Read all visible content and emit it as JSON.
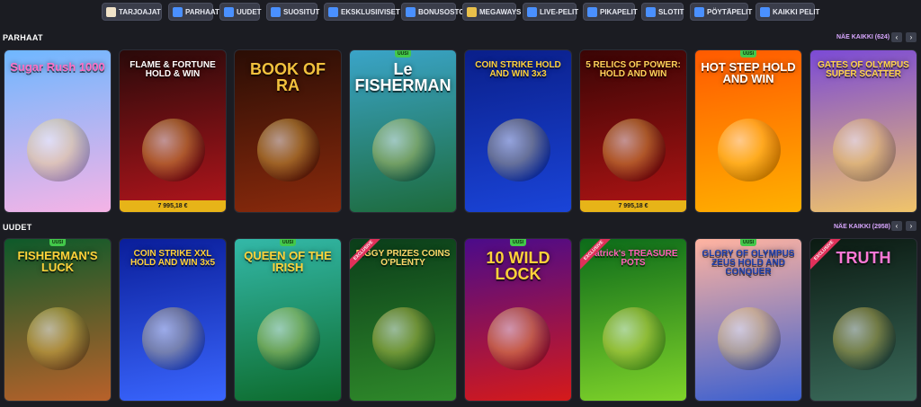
{
  "nav": {
    "chips": [
      {
        "label": "TARJOAJAT",
        "icon": "provider-icon",
        "color": "#f0e2c8"
      },
      {
        "label": "PARHAAT",
        "icon": "star-icon",
        "color": "#4a90ff"
      },
      {
        "label": "UUDET",
        "icon": "lightning-icon",
        "color": "#4a90ff"
      },
      {
        "label": "SUOSITUT",
        "icon": "flame-icon",
        "color": "#4a90ff"
      },
      {
        "label": "EKSKLUSIIVISET",
        "icon": "diamond-icon",
        "color": "#4a90ff"
      },
      {
        "label": "BONUSOSTO",
        "icon": "gift-icon",
        "color": "#4a90ff"
      },
      {
        "label": "MEGAWAYS",
        "icon": "megaways-icon",
        "color": "#e9c04a"
      },
      {
        "label": "LIVE-PELIT",
        "icon": "live-icon",
        "color": "#4a90ff"
      },
      {
        "label": "PIKAPELIT",
        "icon": "gamepad-icon",
        "color": "#4a90ff"
      },
      {
        "label": "SLOTIT",
        "icon": "slots-icon",
        "color": "#4a90ff"
      },
      {
        "label": "PÖYTÄPELIT",
        "icon": "cards-icon",
        "color": "#4a90ff"
      },
      {
        "label": "KAIKKI PELIT",
        "icon": "rocket-icon",
        "color": "#4a90ff"
      }
    ]
  },
  "sections": [
    {
      "title": "PARHAAT",
      "view_all": "NÄE KAIKKI (624)",
      "games": [
        {
          "title": "Sugar Rush 1000",
          "badge": "",
          "exclusive": "",
          "jackpot": "",
          "bg1": "#6fb7ff",
          "bg2": "#f5b3e6",
          "color": "#ff6fc4"
        },
        {
          "title": "FLAME & FORTUNE HOLD & WIN",
          "badge": "",
          "exclusive": "",
          "jackpot": "7 995,18 €",
          "bg1": "#2a0a0a",
          "bg2": "#b3151c",
          "color": "#ffffff"
        },
        {
          "title": "BOOK OF RA",
          "badge": "",
          "exclusive": "",
          "jackpot": "",
          "bg1": "#2a0d05",
          "bg2": "#8a2a0c",
          "color": "#f2c13d"
        },
        {
          "title": "Le FISHERMAN",
          "badge": "UUSI",
          "exclusive": "",
          "jackpot": "",
          "bg1": "#3aa4c8",
          "bg2": "#1d6b3c",
          "color": "#ffffff"
        },
        {
          "title": "COIN STRIKE HOLD AND WIN 3x3",
          "badge": "",
          "exclusive": "",
          "jackpot": "",
          "bg1": "#0a1f8a",
          "bg2": "#1a44d8",
          "color": "#ffd23a"
        },
        {
          "title": "5 RELICS OF POWER: HOLD AND WIN",
          "badge": "",
          "exclusive": "",
          "jackpot": "7 995,18 €",
          "bg1": "#3a0505",
          "bg2": "#b01414",
          "color": "#ffd35a"
        },
        {
          "title": "HOT STEP HOLD AND WIN",
          "badge": "UUSI",
          "exclusive": "",
          "jackpot": "",
          "bg1": "#ff5a00",
          "bg2": "#ffb000",
          "color": "#ffffff"
        },
        {
          "title": "GATES OF OLYMPUS SUPER SCATTER",
          "badge": "",
          "exclusive": "",
          "jackpot": "",
          "bg1": "#7b4ad6",
          "bg2": "#f0c46a",
          "color": "#ffd34a"
        }
      ]
    },
    {
      "title": "UUDET",
      "view_all": "NÄE KAIKKI (2958)",
      "games": [
        {
          "title": "FISHERMAN'S LUCK",
          "badge": "UUSI",
          "exclusive": "",
          "jackpot": "",
          "bg1": "#0d5a2a",
          "bg2": "#b8612a",
          "color": "#ffd23a"
        },
        {
          "title": "COIN STRIKE XXL HOLD AND WIN 3x5",
          "badge": "",
          "exclusive": "",
          "jackpot": "",
          "bg1": "#0a1e9a",
          "bg2": "#3a66ff",
          "color": "#ffd23a"
        },
        {
          "title": "QUEEN OF THE IRISH",
          "badge": "UUSI",
          "exclusive": "",
          "jackpot": "",
          "bg1": "#33b8a8",
          "bg2": "#0d6b2c",
          "color": "#ffd23a"
        },
        {
          "title": "PIGGY PRIZES COINS O'PLENTY",
          "badge": "",
          "exclusive": "EXCLUSIVE",
          "jackpot": "",
          "bg1": "#0b3d1a",
          "bg2": "#2f8a2a",
          "color": "#ffd86b"
        },
        {
          "title": "10 WILD LOCK",
          "badge": "UUSI",
          "exclusive": "",
          "jackpot": "",
          "bg1": "#4b0b8a",
          "bg2": "#d51a1a",
          "color": "#ffd23a"
        },
        {
          "title": "Patrick's TREASURE POTS",
          "badge": "",
          "exclusive": "EXCLUSIVE",
          "jackpot": "",
          "bg1": "#0c6b1a",
          "bg2": "#7fd32a",
          "color": "#ff5fb8"
        },
        {
          "title": "GLORY OF OLYMPUS ZEUS HOLD AND CONQUER",
          "badge": "UUSI",
          "exclusive": "",
          "jackpot": "",
          "bg1": "#ffb3a0",
          "bg2": "#3a5fd0",
          "color": "#1b3fae"
        },
        {
          "title": "TRUTH",
          "badge": "",
          "exclusive": "EXCLUSIVE",
          "jackpot": "",
          "bg1": "#0b1a12",
          "bg2": "#3a6a5a",
          "color": "#ff78d6"
        }
      ]
    }
  ]
}
